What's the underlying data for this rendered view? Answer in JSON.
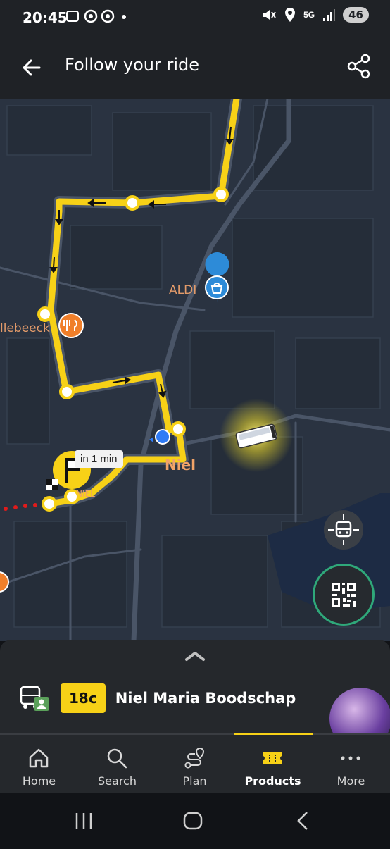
{
  "status_bar": {
    "time": "20:45",
    "left_icons": [
      "screenshot-icon",
      "threads-icon",
      "threads-icon",
      "dot-icon"
    ],
    "right_icons": [
      "mute-icon",
      "location-icon",
      "5g-icon",
      "signal-icon"
    ],
    "network": "5G",
    "battery": "46"
  },
  "header": {
    "title": "Follow your ride",
    "back_icon": "arrow-left-icon",
    "share_icon": "share-icon"
  },
  "map": {
    "labels": {
      "aldi": "ALDI",
      "restaurant": "llebeeck",
      "niel": "Niel",
      "stop": "NIEL",
      "eta": "in 1 min"
    },
    "colors": {
      "route": "#f7d117",
      "map_bg": "#2a3341",
      "roads": "#3a4657",
      "user_dot": "#2f7bf5",
      "aldi_pin": "#2d8bd8",
      "food_pin": "#f07f2a",
      "qr_ring": "#2fa87a"
    }
  },
  "ride": {
    "line": "18c",
    "name": "Niel Maria Boodschap"
  },
  "nav": {
    "items": [
      {
        "label": "Home",
        "icon": "home-icon"
      },
      {
        "label": "Search",
        "icon": "search-icon"
      },
      {
        "label": "Plan",
        "icon": "route-icon"
      },
      {
        "label": "Products",
        "icon": "ticket-icon",
        "active": true
      },
      {
        "label": "More",
        "icon": "more-icon"
      }
    ]
  }
}
